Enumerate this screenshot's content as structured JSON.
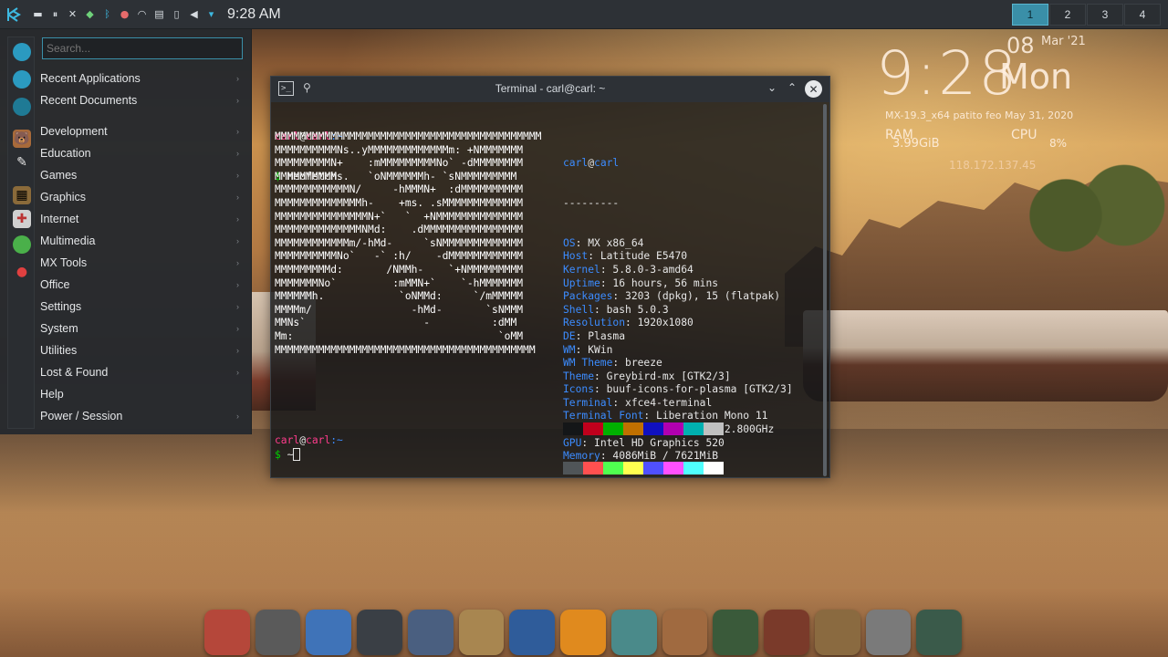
{
  "panel": {
    "clock": "9:28 AM",
    "tray_icons": [
      "network-icon",
      "pause-icon",
      "tools-icon",
      "shield-icon",
      "bluetooth-icon",
      "updates-icon",
      "wifi-icon",
      "clipboard-icon",
      "battery-icon",
      "volume-icon",
      "expand-icon"
    ],
    "desktops": [
      "1",
      "2",
      "3",
      "4"
    ],
    "active_desktop": "1"
  },
  "menu": {
    "search_placeholder": "Search...",
    "items": [
      {
        "label": "Recent Applications"
      },
      {
        "label": "Recent Documents"
      },
      {
        "label": "Development"
      },
      {
        "label": "Education"
      },
      {
        "label": "Games"
      },
      {
        "label": "Graphics"
      },
      {
        "label": "Internet"
      },
      {
        "label": "Multimedia"
      },
      {
        "label": "MX Tools"
      },
      {
        "label": "Office"
      },
      {
        "label": "Settings"
      },
      {
        "label": "System"
      },
      {
        "label": "Utilities"
      },
      {
        "label": "Lost & Found"
      },
      {
        "label": "Help"
      },
      {
        "label": "Power / Session"
      }
    ]
  },
  "terminal": {
    "title": "Terminal - carl@carl: ~",
    "prompt_user": "carl",
    "prompt_at": "@",
    "prompt_host": "carl",
    "prompt_path": ":~",
    "command": "neofetch",
    "ascii": [
      "MMMMMMMMMMMMMMMMMMMMMMMMMMMMMMMMMMMMMMMMMMM",
      "MMMMMMMMMMNs..yMMMMMMMMMMMMMm: +NMMMMMMM",
      "MMMMMMMMMN+    :mMMMMMMMMMNo` -dMMMMMMMM",
      "MMMMMMMMMMs.   `oNMMMMMMh- `sNMMMMMMMMM",
      "MMMMMMMMMMMMN/     -hMMMN+  :dMMMMMMMMMM",
      "MMMMMMMMMMMMMMh-    +ms. .sMMMMMMMMMMMMM",
      "MMMMMMMMMMMMMMMN+`   `  +NMMMMMMMMMMMMMM",
      "MMMMMMMMMMMMMMNMd:    .dMMMMMMMMMMMMMMMM",
      "MMMMMMMMMMMMm/-hMd-     `sNMMMMMMMMMMMMM",
      "MMMMMMMMMMNo`   -` :h/    -dMMMMMMMMMMMM",
      "MMMMMMMMMd:       /NMMh-    `+NMMMMMMMMM",
      "MMMMMMMNo`         :mMMN+`    `-hMMMMMMM",
      "MMMMMMh.            `oNMMd:     `/mMMMMM",
      "MMMMm/                -hMd-       `sNMMM",
      "MMNs`                   -          :dMM",
      "Mm:                                 `oMM",
      "MMMMMMMMMMMMMMMMMMMMMMMMMMMMMMMMMMMMMMMMMM"
    ],
    "info_user": "carl",
    "info_host": "carl",
    "separator": "---------",
    "info": [
      {
        "key": "OS",
        "value": "MX x86_64"
      },
      {
        "key": "Host",
        "value": "Latitude E5470"
      },
      {
        "key": "Kernel",
        "value": "5.8.0-3-amd64"
      },
      {
        "key": "Uptime",
        "value": "16 hours, 56 mins"
      },
      {
        "key": "Packages",
        "value": "3203 (dpkg), 15 (flatpak)"
      },
      {
        "key": "Shell",
        "value": "bash 5.0.3"
      },
      {
        "key": "Resolution",
        "value": "1920x1080"
      },
      {
        "key": "DE",
        "value": "Plasma"
      },
      {
        "key": "WM",
        "value": "KWin"
      },
      {
        "key": "WM Theme",
        "value": "breeze"
      },
      {
        "key": "Theme",
        "value": "Greybird-mx [GTK2/3]"
      },
      {
        "key": "Icons",
        "value": "buuf-icons-for-plasma [GTK2/3]"
      },
      {
        "key": "Terminal",
        "value": "xfce4-terminal"
      },
      {
        "key": "Terminal Font",
        "value": "Liberation Mono 11"
      },
      {
        "key": "CPU",
        "value": "Intel i5-6200U (4) @ 2.800GHz"
      },
      {
        "key": "GPU",
        "value": "Intel HD Graphics 520"
      },
      {
        "key": "Memory",
        "value": "4086MiB / 7621MiB"
      }
    ],
    "palette_dark": [
      "#141618",
      "#c0001c",
      "#00b000",
      "#c07000",
      "#1010c0",
      "#b000b0",
      "#00b0b0",
      "#c0c0c0"
    ],
    "palette_bright": [
      "#505558",
      "#ff5050",
      "#50ff50",
      "#ffff50",
      "#5050ff",
      "#ff50ff",
      "#50ffff",
      "#ffffff"
    ],
    "prompt2_path": ":~",
    "prompt2_tilde": "~",
    "prompt_dollar": "$"
  },
  "conky": {
    "time": "9:28",
    "day": "08",
    "month_year": "Mar '21",
    "weekday": "Mon",
    "system": "MX-19.3_x64 patito feo May 31, 2020",
    "ram_label": "RAM",
    "ram_value": "3.99GiB",
    "cpu_label": "CPU",
    "cpu_value": "8%",
    "ip": "118.172.137.45"
  },
  "dock": [
    {
      "name": "firefox-fox-icon",
      "color": "#b5473a"
    },
    {
      "name": "disk-drive-icon",
      "color": "#5a5a5a"
    },
    {
      "name": "file-manager-icon",
      "color": "#3f73b8"
    },
    {
      "name": "terminal-icon",
      "color": "#3a3f45"
    },
    {
      "name": "package-installer-icon",
      "color": "#4a5f80"
    },
    {
      "name": "hammer-tools-icon",
      "color": "#a88650"
    },
    {
      "name": "skull-globe-icon",
      "color": "#2f5c9a"
    },
    {
      "name": "vlc-cone-icon",
      "color": "#e08a1e"
    },
    {
      "name": "robot-icon",
      "color": "#4a8a8a"
    },
    {
      "name": "bear-search-icon",
      "color": "#a06a40"
    },
    {
      "name": "system-monitor-icon",
      "color": "#3a5a3a"
    },
    {
      "name": "tv-icon",
      "color": "#7a3a2a"
    },
    {
      "name": "archive-manager-icon",
      "color": "#8a6a40"
    },
    {
      "name": "media-player-icon",
      "color": "#7a7a7a"
    },
    {
      "name": "clock-icon",
      "color": "#3a5a4a"
    }
  ]
}
